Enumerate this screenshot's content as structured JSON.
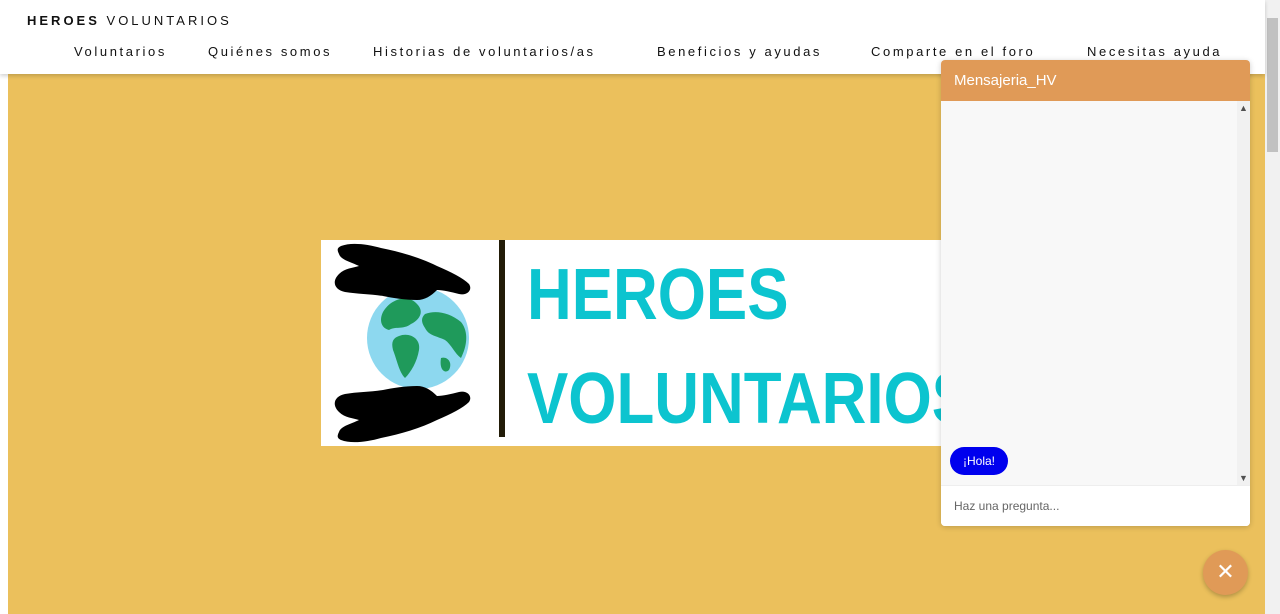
{
  "header": {
    "brand_bold": "HEROES",
    "brand_rest": " VOLUNTARIOS",
    "nav": [
      {
        "label": "Voluntarios"
      },
      {
        "label": "Quiénes somos"
      },
      {
        "label": "Historias de voluntarios/as"
      },
      {
        "label": "Beneficios y ayudas"
      },
      {
        "label": "Comparte en el foro"
      },
      {
        "label": "Necesitas ayuda"
      }
    ]
  },
  "hero": {
    "logo_line1": "HEROES",
    "logo_line2": "VOLUNTARIOS"
  },
  "chat": {
    "title": "Mensajeria_HV",
    "messages": [
      {
        "text": "¡Hola!"
      }
    ],
    "input_placeholder": "Haz una pregunta...",
    "close_icon": "✕"
  },
  "colors": {
    "hero_bg": "#ebc05c",
    "accent": "#e09a57",
    "logo_text": "#0cc4cf",
    "bubble": "#0000ee"
  }
}
